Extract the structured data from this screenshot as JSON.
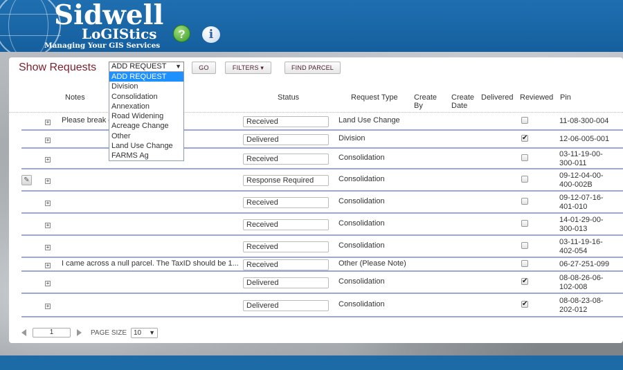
{
  "header": {
    "logo_main": "Sidwell",
    "logo_sub": "LoGIStics",
    "logo_tagline": "Managing Your GIS Services",
    "help_icon": "question-circle-icon",
    "info_icon": "info-circle-icon",
    "help_glyph": "?",
    "info_glyph": "i",
    "brand_color": "#1f6fb0"
  },
  "toolbar": {
    "title": "Show Requests",
    "select_value": "ADD REQUEST",
    "select_caret": "▼",
    "go_label": "GO",
    "filters_label": "FILTERS ▾",
    "find_parcel_label": "FIND PARCEL"
  },
  "dropdown": {
    "options": [
      "ADD REQUEST",
      "Division",
      "Consolidation",
      "Annexation",
      "Road Widening",
      "Acreage Change",
      "Other",
      "Land Use Change",
      "FARMS Ag"
    ],
    "selected_index": 0
  },
  "table": {
    "headers": {
      "notes": "Notes",
      "status": "Status",
      "request_type": "Request Type",
      "create_by": "Create By",
      "create_date": "Create Date",
      "delivered": "Delivered",
      "reviewed": "Reviewed",
      "pin": "Pin"
    },
    "rows": [
      {
        "note": "Please break o",
        "status": "Received",
        "request_type": "Land Use Change",
        "reviewed": false,
        "pin": "11-08-300-004",
        "editable": false
      },
      {
        "note": "",
        "status": "Delivered",
        "request_type": "Division",
        "reviewed": true,
        "pin": "12-06-005-001",
        "editable": false
      },
      {
        "note": "",
        "status": "Received",
        "request_type": "Consolidation",
        "reviewed": false,
        "pin": "03-11-19-00-300-011",
        "editable": false
      },
      {
        "note": "",
        "status": "Response Required",
        "request_type": "Consolidation",
        "reviewed": false,
        "pin": "09-12-04-00-400-002B",
        "editable": true
      },
      {
        "note": "",
        "status": "Received",
        "request_type": "Consolidation",
        "reviewed": false,
        "pin": "09-12-07-16-401-010",
        "editable": false
      },
      {
        "note": "",
        "status": "Received",
        "request_type": "Consolidation",
        "reviewed": false,
        "pin": "14-01-29-00-300-013",
        "editable": false
      },
      {
        "note": "",
        "status": "Received",
        "request_type": "Consolidation",
        "reviewed": false,
        "pin": "03-11-19-16-402-054",
        "editable": false
      },
      {
        "note": "I came across a null parcel. The TaxID should be 1...",
        "status": "Received",
        "request_type": "Other (Please Note)",
        "reviewed": false,
        "pin": "06-27-251-099",
        "editable": false
      },
      {
        "note": "",
        "status": "Delivered",
        "request_type": "Consolidation",
        "reviewed": true,
        "pin": "08-08-26-06-102-008",
        "editable": false
      },
      {
        "note": "",
        "status": "Delivered",
        "request_type": "Consolidation",
        "reviewed": true,
        "pin": "08-08-23-08-202-012",
        "editable": false
      }
    ]
  },
  "pager": {
    "page": "1",
    "page_size_label": "PAGE SIZE",
    "page_size": "10",
    "caret": "▼"
  }
}
